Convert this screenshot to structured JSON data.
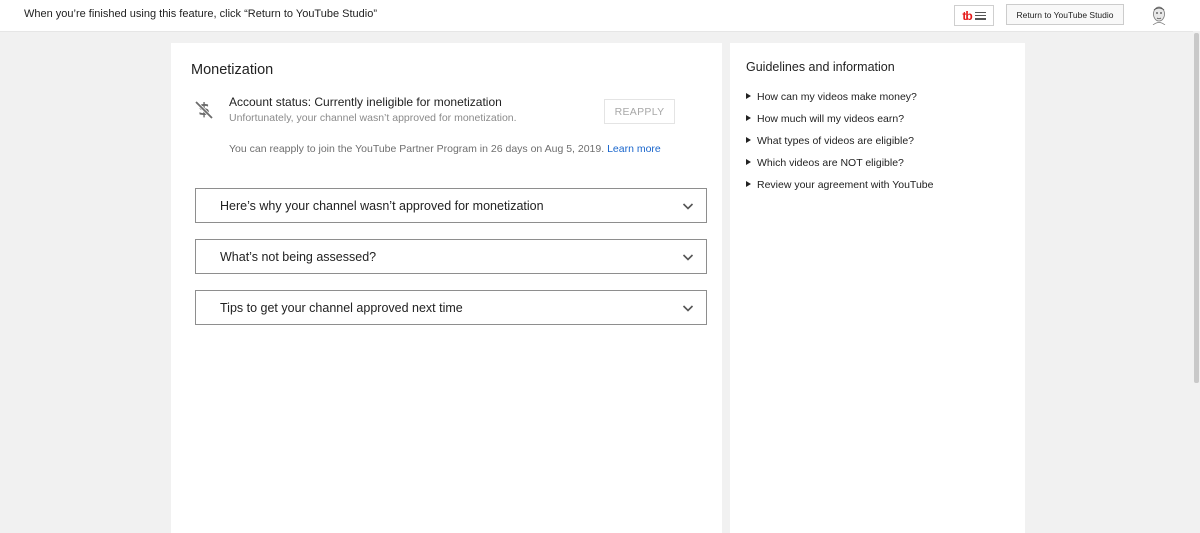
{
  "topbar": {
    "notice": "When you’re finished using this feature, click “Return to YouTube Studio”",
    "extension_logo": "tb",
    "return_label": "Return to YouTube Studio"
  },
  "monetization": {
    "title": "Monetization",
    "status": "Account status: Currently ineligible for monetization",
    "status_sub": "Unfortunately, your channel wasn’t approved for monetization.",
    "reapply_label": "REAPPLY",
    "reapply_info": "You can reapply to join the YouTube Partner Program in 26 days on Aug 5, 2019.",
    "learn_more": "Learn more",
    "accordions": [
      {
        "label": "Here’s why your channel wasn’t approved for monetization"
      },
      {
        "label": "What’s not being assessed?"
      },
      {
        "label": "Tips to get your channel approved next time"
      }
    ]
  },
  "guidelines": {
    "title": "Guidelines and information",
    "items": [
      {
        "label": "How can my videos make money?"
      },
      {
        "label": "How much will my videos earn?"
      },
      {
        "label": "What types of videos are eligible?"
      },
      {
        "label": "Which videos are NOT eligible?"
      },
      {
        "label": "Review your agreement with YouTube"
      }
    ]
  },
  "colors": {
    "link": "#1a66cc",
    "extension_red": "#e51a1a",
    "background": "#f1f1f1"
  }
}
